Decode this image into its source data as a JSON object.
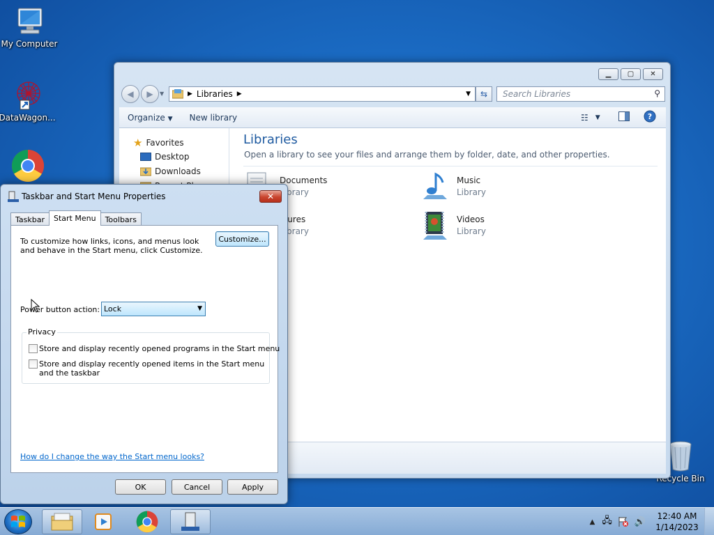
{
  "desktop": {
    "icons": [
      {
        "label": "My Computer"
      },
      {
        "label": "DataWagon..."
      },
      {
        "label": "Recycle Bin"
      }
    ]
  },
  "explorer": {
    "address": {
      "root": "Libraries"
    },
    "search_placeholder": "Search Libraries",
    "toolbar": {
      "organize": "Organize",
      "new_library": "New library"
    },
    "nav": {
      "favorites": "Favorites",
      "desktop": "Desktop",
      "downloads": "Downloads",
      "partial": "Recent Pl"
    },
    "content": {
      "title": "Libraries",
      "subtitle": "Open a library to see your files and arrange them by folder, date, and other properties.",
      "items": [
        {
          "name": "Documents",
          "type": "Library"
        },
        {
          "name": "Music",
          "type": "Library"
        },
        {
          "name": "ctures",
          "type": "Library"
        },
        {
          "name": "Videos",
          "type": "Library"
        }
      ]
    }
  },
  "dialog": {
    "title": "Taskbar and Start Menu Properties",
    "tabs": [
      "Taskbar",
      "Start Menu",
      "Toolbars"
    ],
    "description": "To customize how links, icons, and menus look and behave in the Start menu, click Customize.",
    "customize_label": "Customize...",
    "power_label": "Power button action:",
    "power_value": "Lock",
    "privacy_legend": "Privacy",
    "privacy_programs": "Store and display recently opened programs in the Start menu",
    "privacy_items": "Store and display recently opened items in the Start menu and the taskbar",
    "help_link": "How do I change the way the Start menu looks?",
    "ok": "OK",
    "cancel": "Cancel",
    "apply": "Apply"
  },
  "taskbar": {
    "time": "12:40 AM",
    "date": "1/14/2023"
  }
}
